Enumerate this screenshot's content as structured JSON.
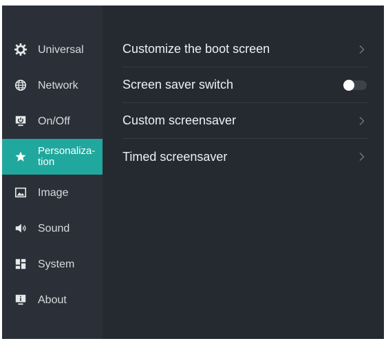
{
  "sidebar": {
    "items": [
      {
        "label": "Universal",
        "icon": "gear-icon"
      },
      {
        "label": "Network",
        "icon": "globe-icon"
      },
      {
        "label": "On/Off",
        "icon": "power-monitor-icon"
      },
      {
        "label": "Personaliza-\ntion",
        "icon": "star-icon",
        "active": true
      },
      {
        "label": "Image",
        "icon": "image-icon"
      },
      {
        "label": "Sound",
        "icon": "speaker-icon"
      },
      {
        "label": "System",
        "icon": "grid-icon"
      },
      {
        "label": "About",
        "icon": "info-monitor-icon"
      }
    ]
  },
  "settings": {
    "rows": [
      {
        "label": "Customize the boot screen",
        "control": "chevron"
      },
      {
        "label": "Screen saver switch",
        "control": "toggle",
        "value": "off"
      },
      {
        "label": "Custom screensaver",
        "control": "chevron"
      },
      {
        "label": "Timed screensaver",
        "control": "chevron"
      }
    ]
  },
  "colors": {
    "accent": "#20a89e",
    "sidebar_bg": "#2b3038",
    "content_bg": "#252a31"
  }
}
